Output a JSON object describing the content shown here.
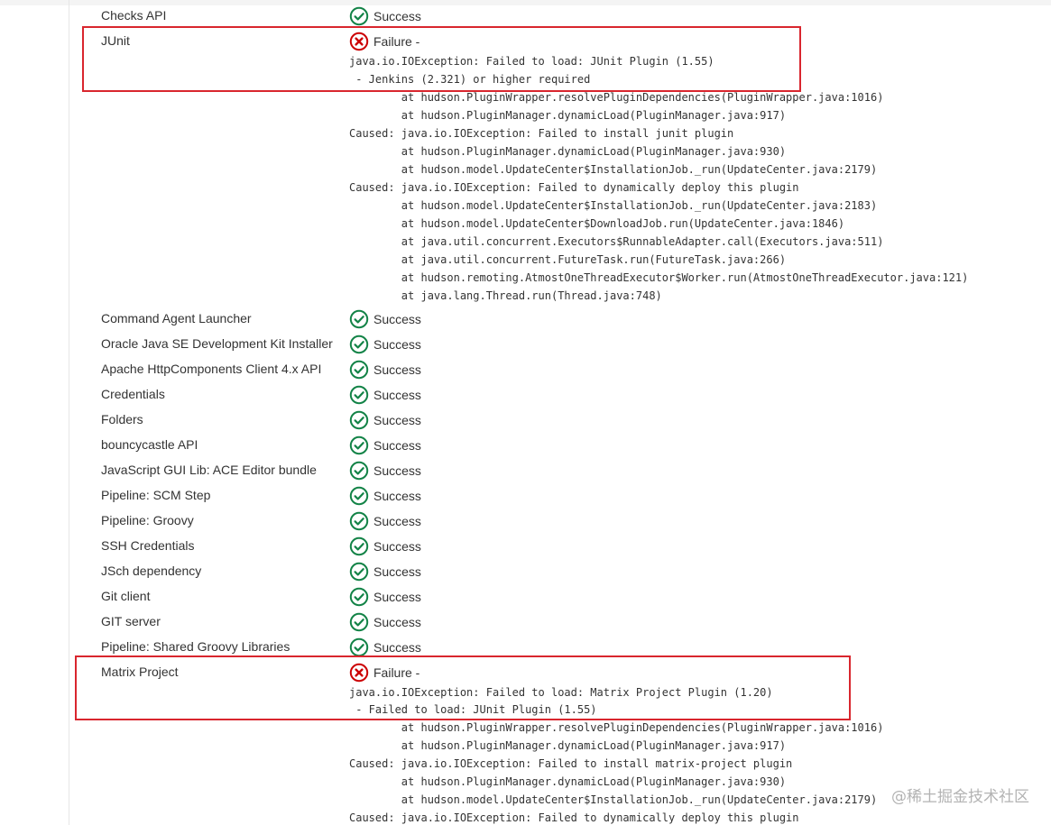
{
  "plugins_top": [
    {
      "name": "Checks API",
      "status": "Success"
    }
  ],
  "junit": {
    "name": "JUnit",
    "status": "Failure -",
    "highlight_lines": [
      "java.io.IOException: Failed to load: JUnit Plugin (1.55)",
      " - Jenkins (2.321) or higher required"
    ],
    "trace": [
      "        at hudson.PluginWrapper.resolvePluginDependencies(PluginWrapper.java:1016)",
      "        at hudson.PluginManager.dynamicLoad(PluginManager.java:917)",
      "Caused: java.io.IOException: Failed to install junit plugin",
      "        at hudson.PluginManager.dynamicLoad(PluginManager.java:930)",
      "        at hudson.model.UpdateCenter$InstallationJob._run(UpdateCenter.java:2179)",
      "Caused: java.io.IOException: Failed to dynamically deploy this plugin",
      "        at hudson.model.UpdateCenter$InstallationJob._run(UpdateCenter.java:2183)",
      "        at hudson.model.UpdateCenter$DownloadJob.run(UpdateCenter.java:1846)",
      "        at java.util.concurrent.Executors$RunnableAdapter.call(Executors.java:511)",
      "        at java.util.concurrent.FutureTask.run(FutureTask.java:266)",
      "        at hudson.remoting.AtmostOneThreadExecutor$Worker.run(AtmostOneThreadExecutor.java:121)",
      "        at java.lang.Thread.run(Thread.java:748)"
    ]
  },
  "plugins_mid": [
    {
      "name": "Command Agent Launcher",
      "status": "Success"
    },
    {
      "name": "Oracle Java SE Development Kit Installer",
      "status": "Success"
    },
    {
      "name": "Apache HttpComponents Client 4.x API",
      "status": "Success"
    },
    {
      "name": "Credentials",
      "status": "Success"
    },
    {
      "name": "Folders",
      "status": "Success"
    },
    {
      "name": "bouncycastle API",
      "status": "Success"
    },
    {
      "name": "JavaScript GUI Lib: ACE Editor bundle",
      "status": "Success"
    },
    {
      "name": "Pipeline: SCM Step",
      "status": "Success"
    },
    {
      "name": "Pipeline: Groovy",
      "status": "Success"
    },
    {
      "name": "SSH Credentials",
      "status": "Success"
    },
    {
      "name": "JSch dependency",
      "status": "Success"
    },
    {
      "name": "Git client",
      "status": "Success"
    },
    {
      "name": "GIT server",
      "status": "Success"
    },
    {
      "name": "Pipeline: Shared Groovy Libraries",
      "status": "Success"
    }
  ],
  "matrix": {
    "name": "Matrix Project",
    "status": "Failure -",
    "highlight_lines": [
      "java.io.IOException: Failed to load: Matrix Project Plugin (1.20)",
      " - Failed to load: JUnit Plugin (1.55)"
    ],
    "trace": [
      "        at hudson.PluginWrapper.resolvePluginDependencies(PluginWrapper.java:1016)",
      "        at hudson.PluginManager.dynamicLoad(PluginManager.java:917)",
      "Caused: java.io.IOException: Failed to install matrix-project plugin",
      "        at hudson.PluginManager.dynamicLoad(PluginManager.java:930)",
      "        at hudson.model.UpdateCenter$InstallationJob._run(UpdateCenter.java:2179)",
      "Caused: java.io.IOException: Failed to dynamically deploy this plugin"
    ]
  },
  "watermark": "@稀土掘金技术社区",
  "colors": {
    "success": "#138347",
    "failure": "#cc0003",
    "highlight_border": "#d9262e"
  },
  "icons": {
    "success": "check-circle-icon",
    "failure": "x-circle-icon"
  }
}
